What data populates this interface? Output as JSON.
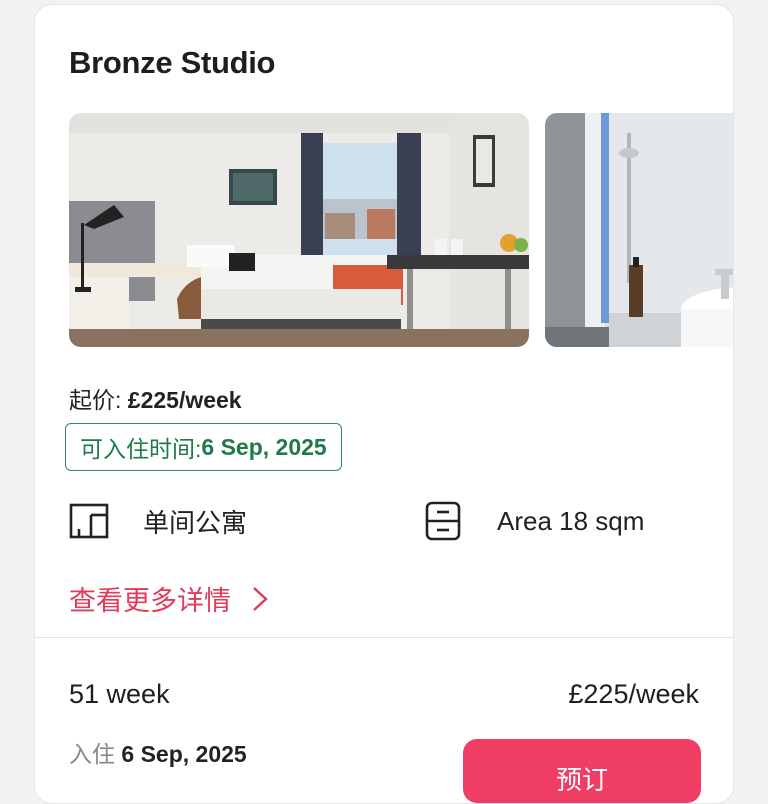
{
  "card": {
    "title": "Bronze Studio",
    "images": [
      {
        "alt": "bedroom-photo"
      },
      {
        "alt": "bathroom-photo"
      }
    ],
    "price_label": "起价:",
    "price_value": "£225/week",
    "availability_label": "可入住时间:",
    "availability_date": "6 Sep, 2025",
    "features": [
      {
        "icon": "room-layout-icon",
        "label": "单间公寓"
      },
      {
        "icon": "cabinet-icon",
        "label": "Area 18 sqm"
      }
    ],
    "more_details": "查看更多详情",
    "tenancy": {
      "weeks": "51 week",
      "price": "£225/week",
      "checkin_label": "入住",
      "checkin_date": "6 Sep, 2025",
      "book_label": "预订"
    }
  },
  "colors": {
    "accent": "#ef3d63",
    "link": "#e23a58",
    "available": "#1f7a4b"
  }
}
